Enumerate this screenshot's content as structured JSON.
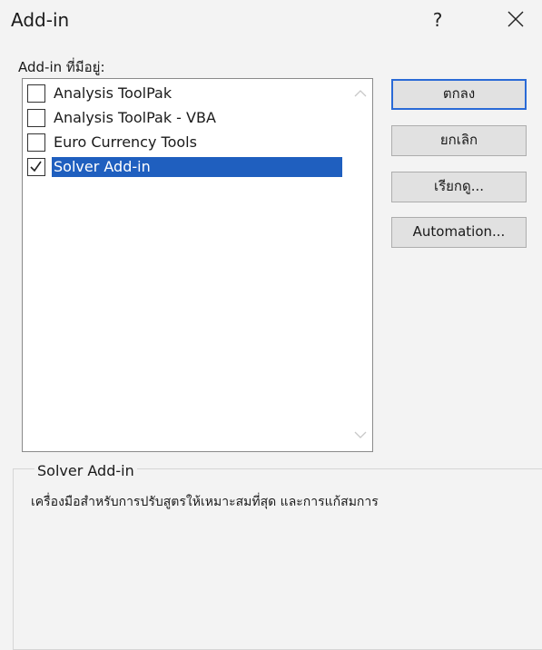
{
  "window": {
    "title": "Add-in",
    "help_label": "?"
  },
  "available_label": "Add-in ที่มีอยู่:",
  "addins": [
    {
      "label": "Analysis ToolPak",
      "checked": false,
      "selected": false
    },
    {
      "label": "Analysis ToolPak - VBA",
      "checked": false,
      "selected": false
    },
    {
      "label": "Euro Currency Tools",
      "checked": false,
      "selected": false
    },
    {
      "label": "Solver Add-in",
      "checked": true,
      "selected": true
    }
  ],
  "buttons": {
    "ok": "ตกลง",
    "cancel": "ยกเลิก",
    "browse": "เรียกดู...",
    "automation": "Automation..."
  },
  "description": {
    "title": "Solver Add-in",
    "text": "เครื่องมือสำหรับการปรับสูตรให้เหมาะสมที่สุด และการแก้สมการ"
  },
  "icons": {
    "close": "close-icon",
    "checkmark": "checkmark-icon",
    "scroll_up": "chevron-up-icon",
    "scroll_down": "chevron-down-icon"
  },
  "colors": {
    "selection": "#1f5fbf",
    "default_button_border": "#2a6ad6",
    "dialog_background": "#f3f3f3"
  }
}
